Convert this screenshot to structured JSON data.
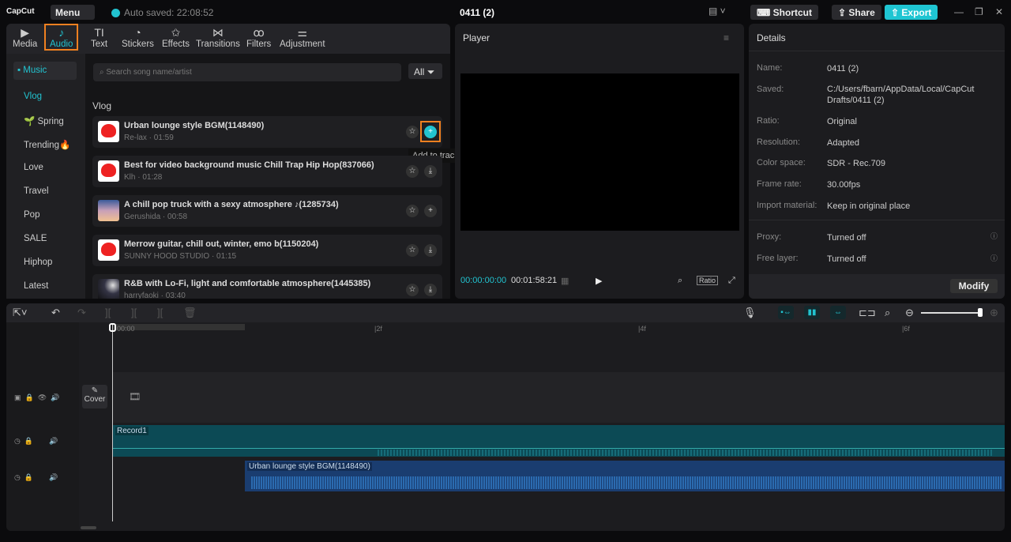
{
  "app": {
    "logo": "CapCut",
    "menu": "Menu",
    "auto_saved": "Auto saved: 22:08:52",
    "project_title": "0411 (2)",
    "shortcut": "Shortcut",
    "share": "Share",
    "export": "Export"
  },
  "tabs": [
    {
      "label": "Media",
      "icon": "▶"
    },
    {
      "label": "Audio",
      "icon": "♪"
    },
    {
      "label": "Text",
      "icon": "TI"
    },
    {
      "label": "Stickers",
      "icon": "◔"
    },
    {
      "label": "Effects",
      "icon": "✩"
    },
    {
      "label": "Transitions",
      "icon": "⋈"
    },
    {
      "label": "Filters",
      "icon": "ꝏ"
    },
    {
      "label": "Adjustment",
      "icon": "⚌"
    }
  ],
  "sidebar": {
    "music": "▪ Music",
    "categories": [
      "Vlog",
      "🌱 Spring",
      "Trending🔥",
      "Love",
      "Travel",
      "Pop",
      "SALE",
      "Hiphop",
      "Latest"
    ]
  },
  "search": {
    "placeholder": "Search song name/artist",
    "filter": "All"
  },
  "section": "Vlog",
  "songs": [
    {
      "title": "Urban lounge style BGM(1148490)",
      "meta": "Re-lax · 01:59"
    },
    {
      "title": "Best for video background music Chill Trap Hip Hop(837066)",
      "meta": "Klh · 01:28"
    },
    {
      "title": "A chill pop truck with a sexy atmosphere ♪(1285734)",
      "meta": "Gerushida · 00:58"
    },
    {
      "title": "Merrow guitar, chill out, winter, emo b(1150204)",
      "meta": "SUNNY HOOD STUDIO · 01:15"
    },
    {
      "title": "R&B with Lo-Fi, light and comfortable atmosphere(1445385)",
      "meta": "harryfaoki · 03:40"
    }
  ],
  "tooltip": "Add to track",
  "player": {
    "title": "Player",
    "current": "00:00:00:00",
    "total": "00:01:58:21",
    "ratio": "Ratio"
  },
  "details": {
    "title": "Details",
    "rows": [
      {
        "label": "Name:",
        "value": "0411 (2)"
      },
      {
        "label": "Saved:",
        "value": "C:/Users/fbarn/AppData/Local/CapCut Drafts/0411 (2)"
      },
      {
        "label": "Ratio:",
        "value": "Original"
      },
      {
        "label": "Resolution:",
        "value": "Adapted"
      },
      {
        "label": "Color space:",
        "value": "SDR - Rec.709"
      },
      {
        "label": "Frame rate:",
        "value": "30.00fps"
      },
      {
        "label": "Import material:",
        "value": "Keep in original place"
      },
      {
        "label": "Proxy:",
        "value": "Turned off"
      },
      {
        "label": "Free layer:",
        "value": "Turned off"
      }
    ],
    "modify": "Modify"
  },
  "timeline": {
    "ticks": [
      "00:00",
      "|2f",
      "|4f",
      "|6f"
    ],
    "cover": "Cover",
    "clips": [
      "Record1",
      "Urban lounge style BGM(1148490)"
    ],
    "zoom_level": 0.95
  }
}
